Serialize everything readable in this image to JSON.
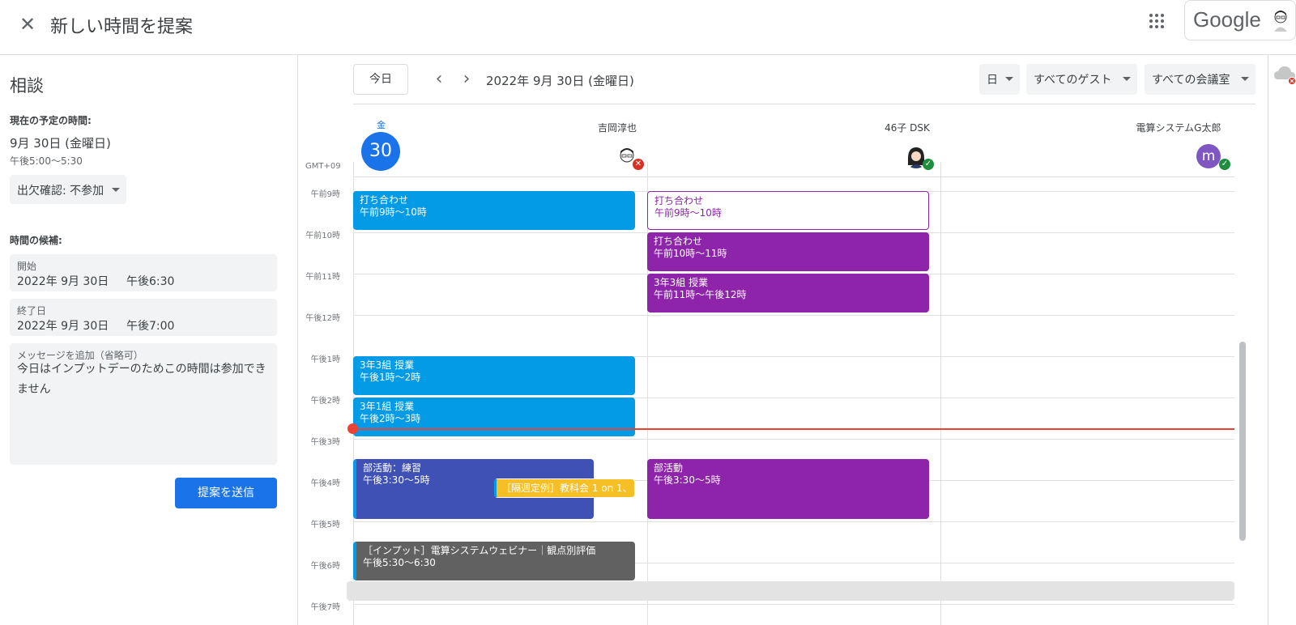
{
  "header": {
    "title": "新しい時間を提案",
    "brand": "Google"
  },
  "left_panel": {
    "event_title": "相談",
    "current_label": "現在の予定の時間:",
    "current_date": "9月 30日 (金曜日)",
    "current_time": "午後5:00〜5:30",
    "rsvp": "出欠確認: 不参加",
    "candidates_label": "時間の候補:",
    "start": {
      "label": "開始",
      "date": "2022年 9月 30日",
      "time": "午後6:30"
    },
    "end": {
      "label": "終了日",
      "date": "2022年 9月 30日",
      "time": "午後7:00"
    },
    "message": {
      "label": "メッセージを追加（省略可）",
      "value": "今日はインプットデーのためこの時間は参加できません"
    },
    "send_label": "提案を送信"
  },
  "toolbar": {
    "today": "今日",
    "prev": "‹",
    "next": "›",
    "date_range": "2022年 9月 30日 (金曜日)",
    "view": "日",
    "guests_filter": "すべてのゲスト",
    "rooms_filter": "すべての会議室"
  },
  "day_header": {
    "weekday": "金",
    "day_number": "30",
    "timezone": "GMT+09"
  },
  "people": [
    {
      "name": "吉岡淳也",
      "status": "declined",
      "avatar_letter": ""
    },
    {
      "name": "46子 DSK",
      "status": "accepted",
      "avatar_letter": ""
    },
    {
      "name": "電算システムG太郎",
      "status": "accepted",
      "avatar_letter": "m"
    }
  ],
  "hours": [
    "午前9時",
    "午前10時",
    "午前11時",
    "午後12時",
    "午後1時",
    "午後2時",
    "午後3時",
    "午後4時",
    "午後5時",
    "午後6時",
    "午後7時"
  ],
  "events": [
    {
      "title": "打ち合わせ",
      "time": "午前9時〜10時"
    },
    {
      "title": "打ち合わせ",
      "time": "午前9時〜10時"
    },
    {
      "title": "打ち合わせ",
      "time": "午前10時〜11時"
    },
    {
      "title": "3年3組 授業",
      "time": "午前11時〜午後12時"
    },
    {
      "title": "3年3組 授業",
      "time": "午後1時〜2時"
    },
    {
      "title": "3年1組 授業",
      "time": "午後2時〜3時"
    },
    {
      "title": "部活動：練習",
      "time": "午後3:30〜5時"
    },
    {
      "title": "［隔週定例］教科会 1 on 1、",
      "time": ""
    },
    {
      "title": "部活動",
      "time": "午後3:30〜5時"
    },
    {
      "title": "［インプット］電算システムウェビナー｜観点別評価",
      "time": "午後5:30〜6:30"
    }
  ],
  "colors": {
    "accent": "#1a73e8",
    "event_blue": "#039be5",
    "event_purple": "#8e24aa",
    "event_indigo": "#3f51b5",
    "event_yellow": "#f6bf26",
    "event_gray": "#616161",
    "now_line": "#ea4335"
  }
}
